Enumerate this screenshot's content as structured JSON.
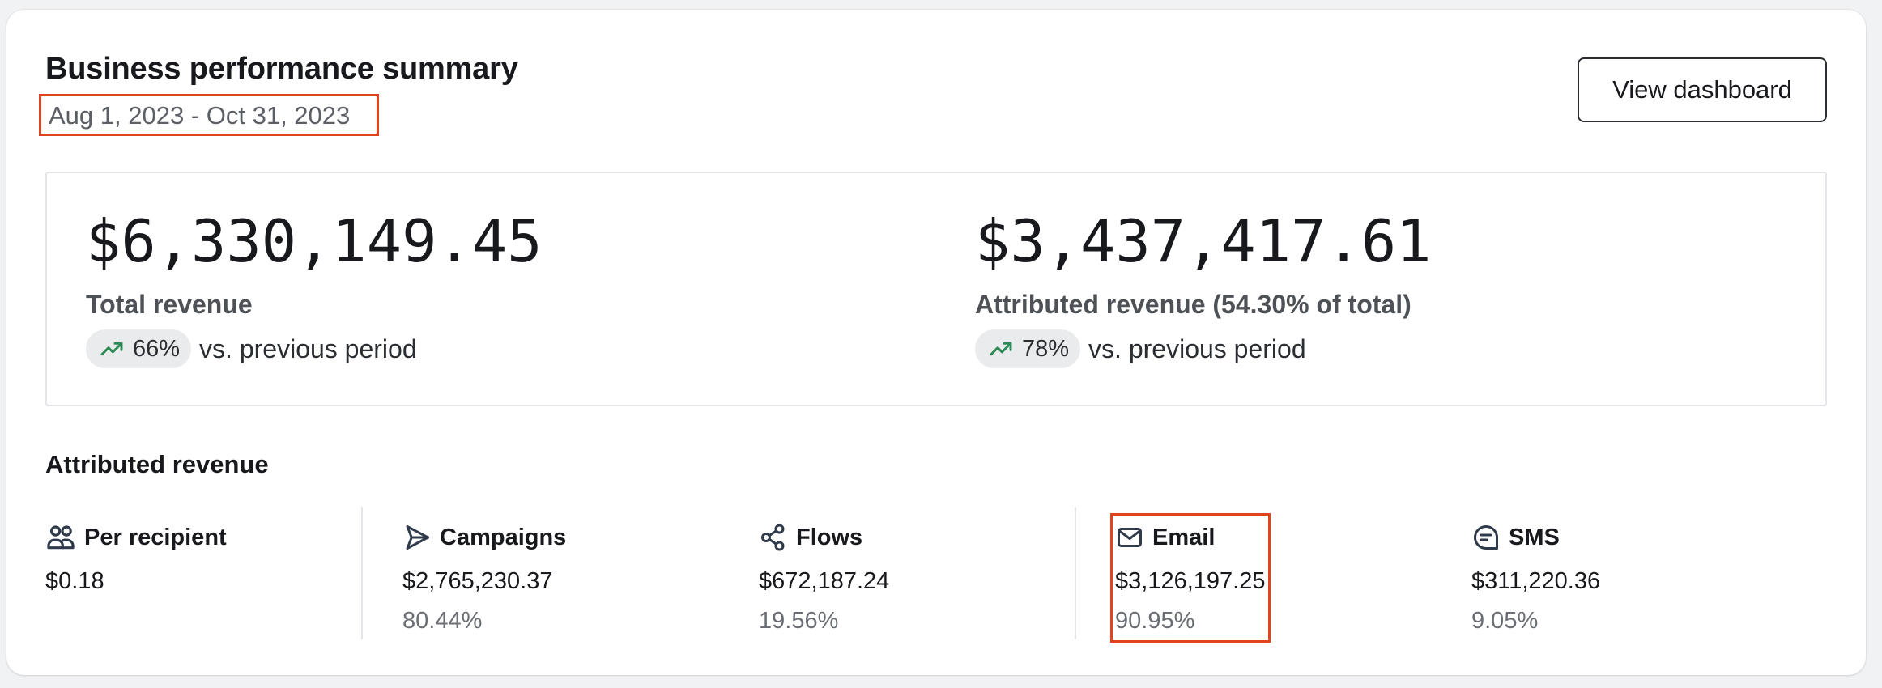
{
  "header": {
    "title": "Business performance summary",
    "date_range": "Aug 1, 2023 - Oct 31, 2023",
    "view_dashboard_label": "View dashboard"
  },
  "summary": {
    "total": {
      "amount": "$6,330,149.45",
      "label": "Total revenue",
      "change": "66%",
      "change_trend": "up",
      "comparison": "vs. previous period"
    },
    "attributed": {
      "amount": "$3,437,417.61",
      "label": "Attributed revenue (54.30% of total)",
      "change": "78%",
      "change_trend": "up",
      "comparison": "vs. previous period"
    }
  },
  "attributed_section": {
    "title": "Attributed revenue",
    "channels": [
      {
        "name": "Per recipient",
        "icon": "people-icon",
        "value": "$0.18",
        "percent": ""
      },
      {
        "name": "Campaigns",
        "icon": "send-icon",
        "value": "$2,765,230.37",
        "percent": "80.44%"
      },
      {
        "name": "Flows",
        "icon": "flows-icon",
        "value": "$672,187.24",
        "percent": "19.56%"
      },
      {
        "name": "Email",
        "icon": "mail-icon",
        "value": "$3,126,197.25",
        "percent": "90.95%"
      },
      {
        "name": "SMS",
        "icon": "sms-icon",
        "value": "$311,220.36",
        "percent": "9.05%"
      }
    ]
  },
  "colors": {
    "trend_up": "#2e8b57",
    "highlight_box": "#e2431f",
    "icon": "#2f3a4a"
  }
}
